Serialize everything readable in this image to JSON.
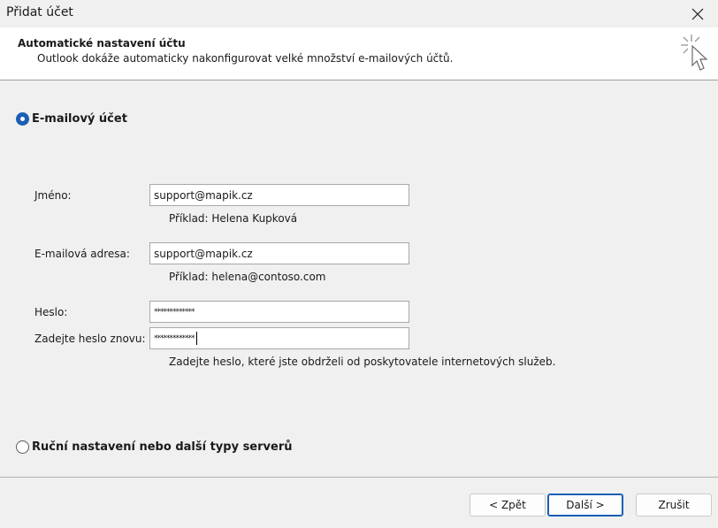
{
  "window": {
    "title": "Přidat účet",
    "close_icon": "close-icon"
  },
  "header": {
    "title": "Automatické nastavení účtu",
    "subtitle": "Outlook dokáže automaticky nakonfigurovat velké množství e-mailových účtů.",
    "icon": "cursor-sparkle-icon"
  },
  "options": {
    "email_account": {
      "label": "E-mailový účet",
      "selected": true
    },
    "manual": {
      "label": "Ruční nastavení nebo další typy serverů",
      "selected": false
    }
  },
  "form": {
    "name": {
      "label": "Jméno:",
      "value": "support@mapik.cz",
      "hint": "Příklad: Helena Kupková"
    },
    "email": {
      "label": "E-mailová adresa:",
      "value": "support@mapik.cz",
      "hint": "Příklad: helena@contoso.com"
    },
    "password": {
      "label": "Heslo:",
      "value": "*************"
    },
    "password_repeat": {
      "label": "Zadejte heslo znovu:",
      "value": "*************"
    },
    "password_hint": "Zadejte heslo, které jste obdrželi od poskytovatele internetových služeb."
  },
  "buttons": {
    "back": "< Zpět",
    "next": "Další >",
    "cancel": "Zrušit"
  },
  "colors": {
    "accent": "#1a5fb4",
    "header_bg": "#ffffff",
    "body_bg": "#f0f0f0"
  }
}
